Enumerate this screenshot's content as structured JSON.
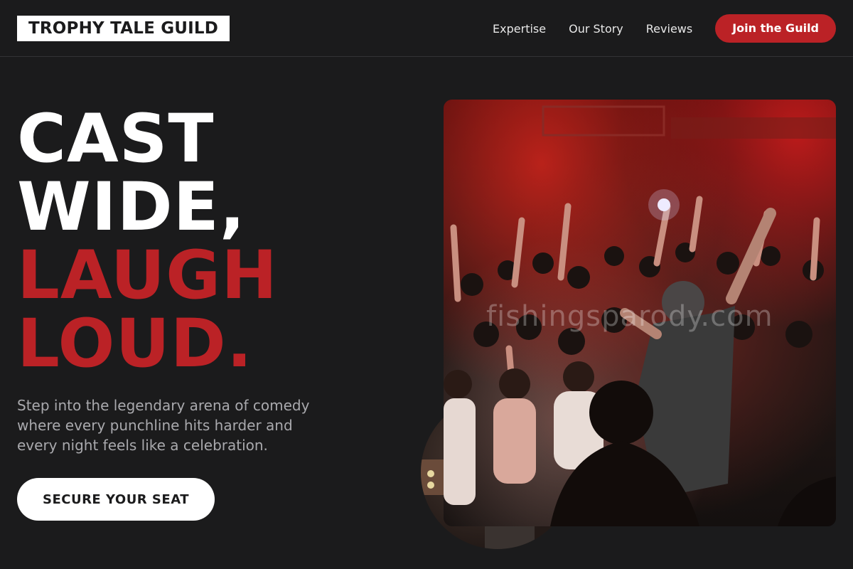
{
  "header": {
    "logo": "TROPHY TALE GUILD",
    "nav": [
      "Expertise",
      "Our Story",
      "Reviews"
    ],
    "cta_label": "Join the Guild"
  },
  "hero": {
    "title_white": [
      "CAST",
      "WIDE,"
    ],
    "title_red": [
      "LAUGH",
      "LOUD."
    ],
    "subtitle": "Step into the legendary arena of comedy where every punchline hits harder and every night feels like a celebration.",
    "button_label": "SECURE YOUR SEAT",
    "image_watermark": "fishingsparody.com"
  },
  "colors": {
    "background": "#1b1b1c",
    "accent": "#bb2226",
    "text": "#ffffff",
    "muted": "#a9a9ad"
  }
}
